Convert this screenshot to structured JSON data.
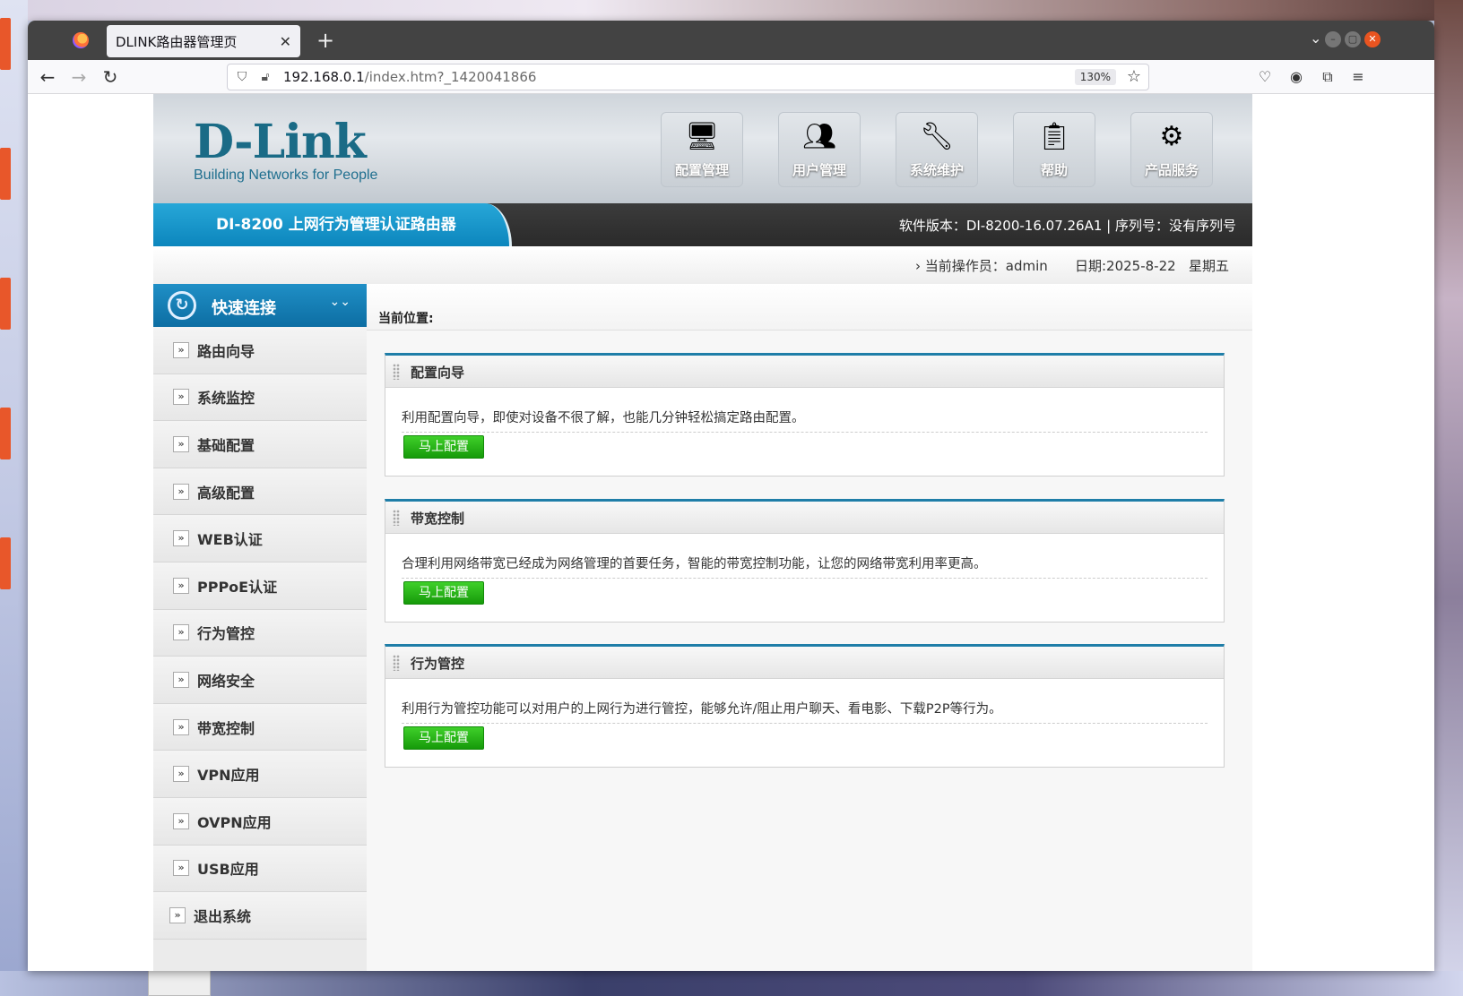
{
  "browser": {
    "tab_title": "DLINK路由器管理页",
    "url_host": "192.168.0.1",
    "url_path": "/index.htm?_1420041866",
    "zoom": "130%"
  },
  "router": {
    "brand": "D-Link",
    "tagline": "Building Networks for People",
    "top_nav": [
      {
        "label": "配置管理",
        "icon": "monitor-icon"
      },
      {
        "label": "用户管理",
        "icon": "users-icon"
      },
      {
        "label": "系统维护",
        "icon": "tools-icon"
      },
      {
        "label": "帮助",
        "icon": "clipboard-icon"
      },
      {
        "label": "产品服务",
        "icon": "sliders-icon"
      }
    ],
    "model_title": "DI-8200  上网行为管理认证路由器",
    "version_info": "软件版本：DI-8200-16.07.26A1 | 序列号：没有序列号",
    "operator": "当前操作员：admin",
    "date": "日期:2025-8-22",
    "weekday": "星期五",
    "sidebar": {
      "header": "快速连接",
      "items": [
        "路由向导",
        "系统监控",
        "基础配置",
        "高级配置",
        "WEB认证",
        "PPPoE认证",
        "行为管控",
        "网络安全",
        "带宽控制",
        "VPN应用",
        "OVPN应用",
        "USB应用",
        "退出系统"
      ]
    },
    "breadcrumb": "当前位置:",
    "panels": [
      {
        "title": "配置向导",
        "desc": "利用配置向导，即使对设备不很了解，也能几分钟轻松搞定路由配置。",
        "button": "马上配置"
      },
      {
        "title": "带宽控制",
        "desc": "合理利用网络带宽已经成为网络管理的首要任务，智能的带宽控制功能，让您的网络带宽利用率更高。",
        "button": "马上配置"
      },
      {
        "title": "行为管控",
        "desc": "利用行为管控功能可以对用户的上网行为进行管控，能够允许/阻止用户聊天、看电影、下载P2P等行为。",
        "button": "马上配置"
      }
    ]
  }
}
